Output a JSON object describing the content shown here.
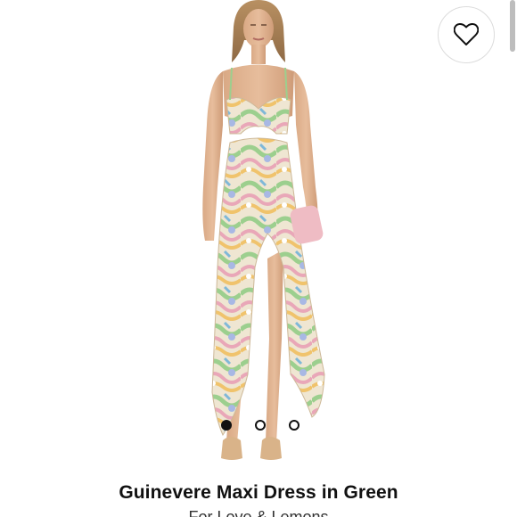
{
  "product": {
    "title": "Guinevere Maxi Dress in Green",
    "brand": "For Love & Lemons"
  },
  "gallery": {
    "total_images": 3,
    "active_index": 0
  },
  "icons": {
    "favorite": "heart-outline-icon"
  },
  "colors": {
    "text": "#111111",
    "background": "#ffffff"
  }
}
